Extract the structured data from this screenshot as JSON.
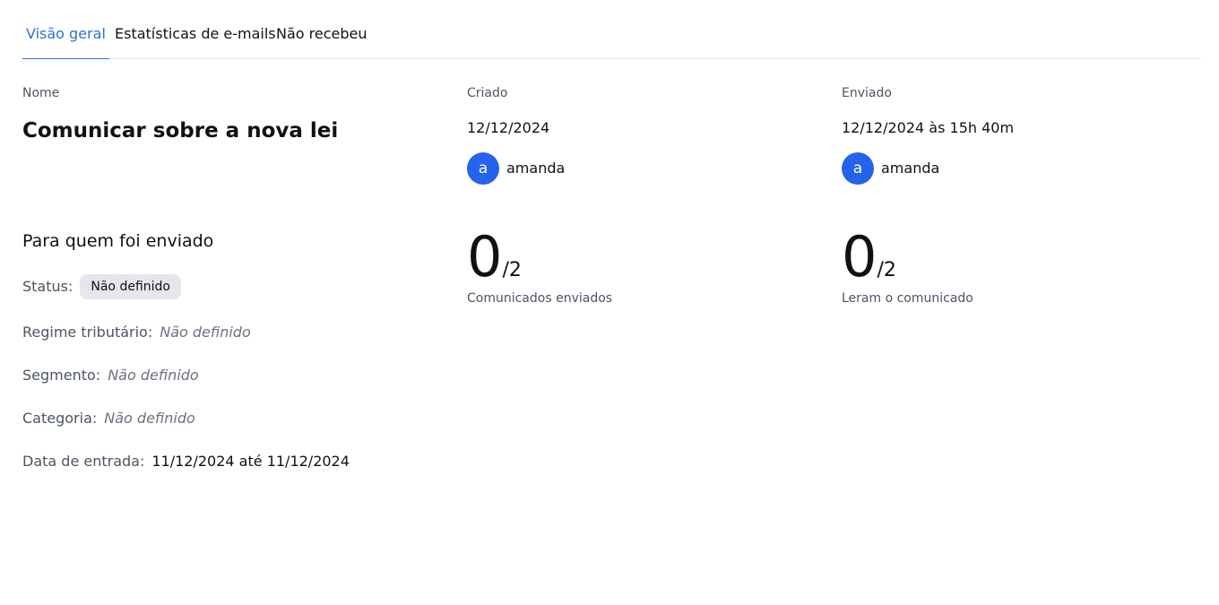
{
  "tabs": [
    {
      "label": "Visão geral",
      "active": true
    },
    {
      "label": "Estatísticas de e-mails",
      "active": false
    },
    {
      "label": "Não recebeu",
      "active": false
    }
  ],
  "overview": {
    "name_label": "Nome",
    "name_value": "Comunicar sobre a nova lei",
    "created": {
      "label": "Criado",
      "date": "12/12/2024",
      "user_initial": "a",
      "user_name": "amanda"
    },
    "sent": {
      "label": "Enviado",
      "date": "12/12/2024 às 15h 40m",
      "user_initial": "a",
      "user_name": "amanda"
    }
  },
  "recipients": {
    "title": "Para quem foi enviado",
    "status_label": "Status:",
    "status_value": "Não definido",
    "regime_label": "Regime tributário:",
    "regime_value": "Não definido",
    "segmento_label": "Segmento:",
    "segmento_value": "Não definido",
    "categoria_label": "Categoria:",
    "categoria_value": "Não definido",
    "data_label": "Data de entrada:",
    "data_value": "11/12/2024 até 11/12/2024"
  },
  "stats": {
    "sent": {
      "count": "0",
      "total": "/2",
      "caption": "Comunicados enviados"
    },
    "read": {
      "count": "0",
      "total": "/2",
      "caption": "Leram o comunicado"
    }
  },
  "colors": {
    "accent": "#2f6fd6",
    "avatar": "#2563eb",
    "badge_bg": "#e5e7eb",
    "muted_text": "#4b5563"
  }
}
